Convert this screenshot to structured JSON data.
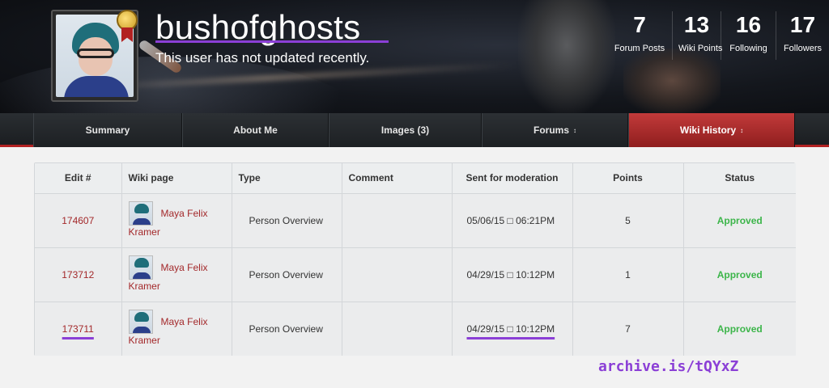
{
  "profile": {
    "username": "bushofghosts",
    "status": "This user has not updated recently."
  },
  "stats": [
    {
      "value": "7",
      "label": "Forum Posts"
    },
    {
      "value": "13",
      "label": "Wiki Points"
    },
    {
      "value": "16",
      "label": "Following"
    },
    {
      "value": "17",
      "label": "Followers"
    }
  ],
  "nav": {
    "tabs": [
      {
        "label": "Summary"
      },
      {
        "label": "About Me"
      },
      {
        "label": "Images (3)"
      },
      {
        "label": "Forums"
      },
      {
        "label": "Wiki History"
      }
    ],
    "active_tab": "Wiki History"
  },
  "table": {
    "headers": [
      "Edit #",
      "Wiki page",
      "Type",
      "Comment",
      "Sent for moderation",
      "Points",
      "Status"
    ],
    "rows": [
      {
        "edit": "174607",
        "page_line1": "Maya Felix",
        "page_line2": "Kramer",
        "type": "Person Overview",
        "comment": "",
        "sent": "05/06/15 □ 06:21PM",
        "points": "5",
        "status": "Approved"
      },
      {
        "edit": "173712",
        "page_line1": "Maya Felix",
        "page_line2": "Kramer",
        "type": "Person Overview",
        "comment": "",
        "sent": "04/29/15 □ 10:12PM",
        "points": "1",
        "status": "Approved"
      },
      {
        "edit": "173711",
        "page_line1": "Maya Felix",
        "page_line2": "Kramer",
        "type": "Person Overview",
        "comment": "",
        "sent": "04/29/15 □ 10:12PM",
        "points": "7",
        "status": "Approved"
      }
    ]
  },
  "watermark": "archive.is/tQYxZ",
  "colors": {
    "accent_red": "#b22222",
    "link_red": "#a3282a",
    "approved_green": "#3cb54a",
    "annotation_purple": "#8b3fd6"
  }
}
